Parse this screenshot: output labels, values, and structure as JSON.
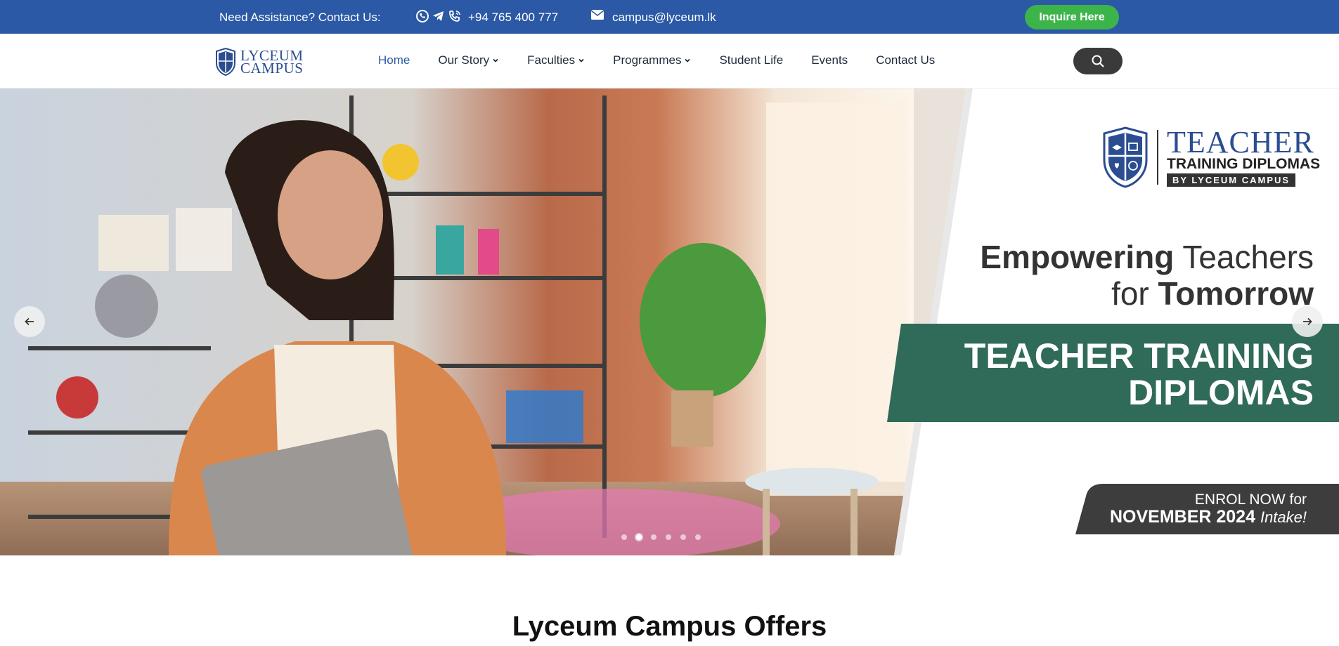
{
  "topbar": {
    "assistance": "Need Assistance? Contact Us:",
    "phone": "+94 765 400 777",
    "email": "campus@lyceum.lk",
    "inquire_label": "Inquire Here"
  },
  "logo": {
    "line1": "LYCEUM",
    "line2": "CAMPUS"
  },
  "nav": {
    "items": [
      {
        "label": "Home",
        "active": true,
        "dropdown": false
      },
      {
        "label": "Our Story",
        "active": false,
        "dropdown": true
      },
      {
        "label": "Faculties",
        "active": false,
        "dropdown": true
      },
      {
        "label": "Programmes",
        "active": false,
        "dropdown": true
      },
      {
        "label": "Student Life",
        "active": false,
        "dropdown": false
      },
      {
        "label": "Events",
        "active": false,
        "dropdown": false
      },
      {
        "label": "Contact Us",
        "active": false,
        "dropdown": false
      }
    ]
  },
  "hero": {
    "brand_title": "TEACHER",
    "brand_subtitle": "TRAINING DIPLOMAS",
    "brand_byline": "BY LYCEUM CAMPUS",
    "tagline_word1": "Empowering",
    "tagline_word2": " Teachers",
    "tagline_word3": "for ",
    "tagline_word4": "Tomorrow",
    "banner_line1": "TEACHER TRAINING",
    "banner_line2": "DIPLOMAS",
    "enrol_line1": "ENROL NOW for",
    "enrol_line2": "NOVEMBER 2024",
    "enrol_line2_suffix": "Intake!",
    "slide_count": 6,
    "active_slide": 2
  },
  "section": {
    "title": "Lyceum Campus Offers"
  },
  "colors": {
    "topbar_bg": "#2b59a5",
    "inquire_bg": "#3cb44a",
    "nav_active": "#2b59a5",
    "banner_green": "#2f6b58",
    "enrol_bg": "#3d3d3d"
  }
}
